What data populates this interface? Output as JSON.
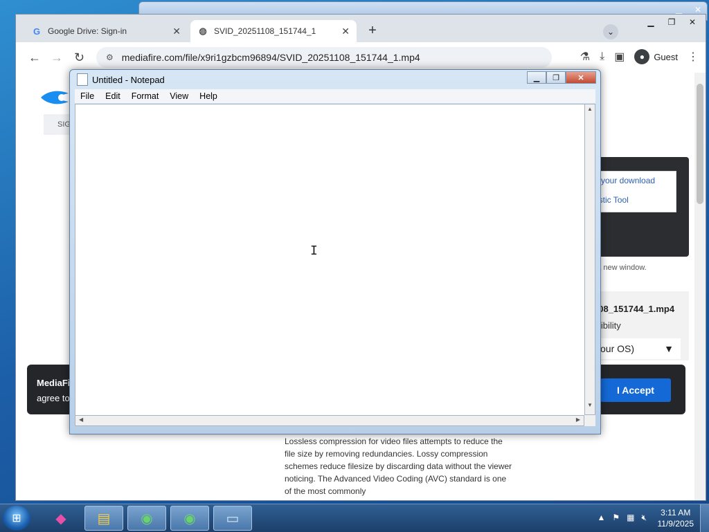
{
  "browser": {
    "tabs": [
      {
        "title": "Google Drive: Sign-in",
        "icon": "google-icon"
      },
      {
        "title": "SVID_20251108_151744_1",
        "icon": "globe-icon"
      }
    ],
    "url": "mediafire.com/file/x9ri1gzbcm96894/SVID_20251108_151744_1.mp4",
    "profile_label": "Guest"
  },
  "page": {
    "sign_label": "SIG",
    "repair_link": "ir your download",
    "diagnostic_link": "ostic Tool",
    "new_window_note": "n a new window.",
    "file_name": "108_151744_1.mp4",
    "compat_label": "atibility",
    "os_select_value": "our OS)",
    "cookie_text_1": "MediaFi",
    "cookie_text_2": "agree to",
    "accept_label": "I Accept",
    "article_text": "Lossless compression for video files attempts to reduce the file size by removing redundancies. Lossy compression schemes reduce filesize by discarding data without the viewer noticing. The Advanced Video Coding (AVC) standard is one of the most commonly"
  },
  "notepad": {
    "title": "Untitled - Notepad",
    "menu": [
      "File",
      "Edit",
      "Format",
      "View",
      "Help"
    ],
    "content": ""
  },
  "taskbar": {
    "time": "3:11 AM",
    "date": "11/9/2025"
  }
}
